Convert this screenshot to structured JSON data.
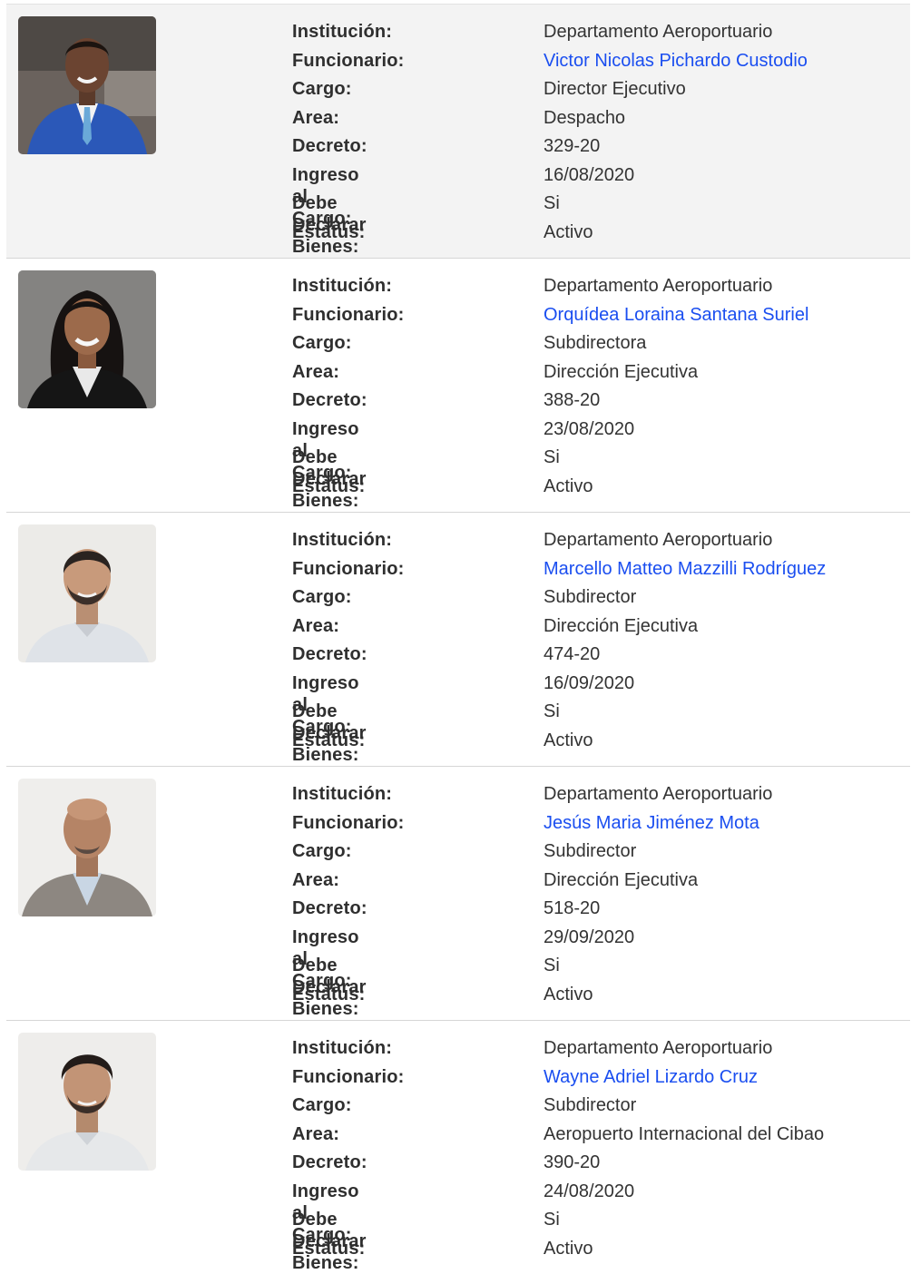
{
  "labels": {
    "institucion": "Institución:",
    "funcionario": "Funcionario:",
    "cargo": "Cargo:",
    "area": "Area:",
    "decreto": "Decreto:",
    "ingreso": "Ingreso al Cargo:",
    "declarar": "Debe Declarar Bienes:",
    "estatus": "Estatus:"
  },
  "officials": [
    {
      "institucion": "Departamento Aeroportuario",
      "funcionario": "Victor Nicolas Pichardo Custodio",
      "cargo": "Director Ejecutivo",
      "area": "Despacho",
      "decreto": "329-20",
      "ingreso": "16/08/2020",
      "declarar": "Si",
      "estatus": "Activo"
    },
    {
      "institucion": "Departamento Aeroportuario",
      "funcionario": "Orquídea Loraina Santana Suriel",
      "cargo": "Subdirectora",
      "area": "Dirección Ejecutiva",
      "decreto": "388-20",
      "ingreso": "23/08/2020",
      "declarar": "Si",
      "estatus": "Activo"
    },
    {
      "institucion": "Departamento Aeroportuario",
      "funcionario": "Marcello Matteo Mazzilli Rodríguez",
      "cargo": "Subdirector",
      "area": "Dirección Ejecutiva",
      "decreto": "474-20",
      "ingreso": "16/09/2020",
      "declarar": "Si",
      "estatus": "Activo"
    },
    {
      "institucion": "Departamento Aeroportuario",
      "funcionario": "Jesús Maria Jiménez Mota",
      "cargo": "Subdirector",
      "area": "Dirección Ejecutiva",
      "decreto": "518-20",
      "ingreso": "29/09/2020",
      "declarar": "Si",
      "estatus": "Activo"
    },
    {
      "institucion": "Departamento Aeroportuario",
      "funcionario": "Wayne Adriel Lizardo Cruz",
      "cargo": "Subdirector",
      "area": "Aeropuerto Internacional del Cibao",
      "decreto": "390-20",
      "ingreso": "24/08/2020",
      "declarar": "Si",
      "estatus": "Activo"
    }
  ],
  "colors": {
    "link": "#1a4ef0",
    "label": "#2f2f2f",
    "first_row_background": "#f3f3f3"
  }
}
